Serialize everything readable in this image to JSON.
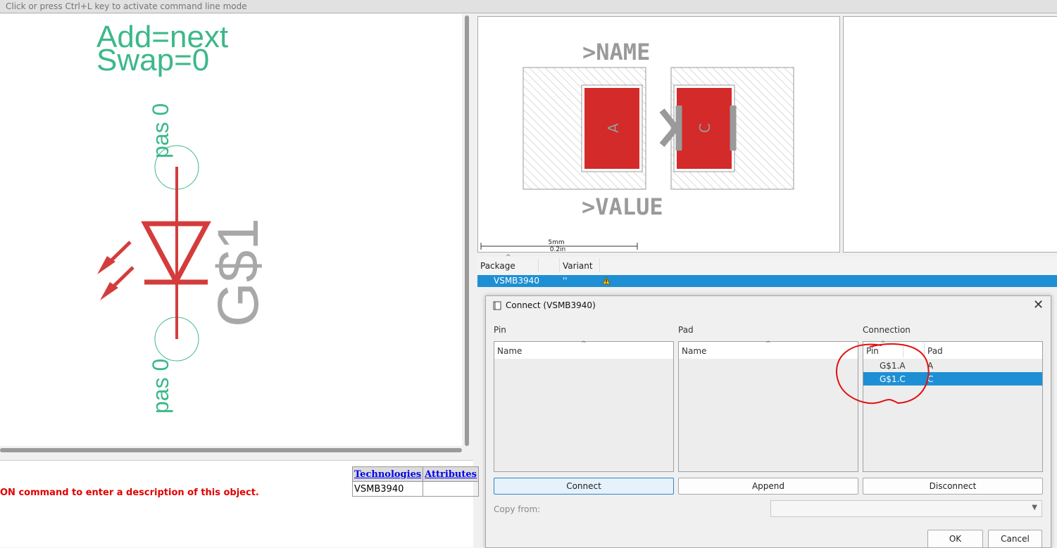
{
  "command_line": {
    "placeholder": "Click or press Ctrl+L key to activate command line mode"
  },
  "schematic": {
    "add_text": "Add=next",
    "swap_text": "Swap=0",
    "pin_top_label": "pas 0",
    "pin_bottom_label": "pas 0",
    "part_name": "G$1",
    "symbol_color": "#d43c3c",
    "text_color": "#3cb88a",
    "name_color": "#a8a8a8"
  },
  "description": {
    "text": "ON command to enter a description of this object.",
    "technologies_header": "Technologies",
    "attributes_header": "Attributes",
    "technology_value": "VSMB3940",
    "attribute_value": ""
  },
  "package_preview": {
    "name_label": ">NAME",
    "value_label": ">VALUE",
    "pad_a": "A",
    "pad_c": "C",
    "scale_mm": "5mm",
    "scale_in": "0.2in",
    "pad_color": "#d42a2a"
  },
  "package_table": {
    "col_package": "Package",
    "col_variant": "Variant",
    "rows": [
      {
        "package": "VSMB3940",
        "variant": "''",
        "status_icon": "warning-icon"
      }
    ]
  },
  "connect_dialog": {
    "title": "Connect  (VSMB3940)",
    "pin_section": "Pin",
    "pad_section": "Pad",
    "connection_section": "Connection",
    "pin_col_name": "Name",
    "pad_col_name": "Name",
    "conn_col_pin": "Pin",
    "conn_col_pad": "Pad",
    "connections": [
      {
        "pin": "G$1.A",
        "pad": "A"
      },
      {
        "pin": "G$1.C",
        "pad": "C"
      }
    ],
    "connect_label": "Connect",
    "append_label": "Append",
    "disconnect_label": "Disconnect",
    "copy_from_label": "Copy from:",
    "ok_label": "OK",
    "cancel_label": "Cancel",
    "selection_color": "#1e8fd4"
  }
}
